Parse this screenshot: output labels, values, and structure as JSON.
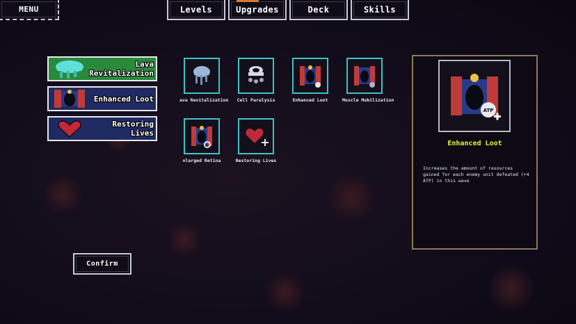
{
  "header": {
    "menu_label": "MENU",
    "nav": [
      {
        "label": "Levels"
      },
      {
        "label": "Upgrades"
      },
      {
        "label": "Deck"
      },
      {
        "label": "Skills"
      }
    ]
  },
  "selected_list": [
    {
      "line1": "Lava",
      "line2": "Revitalization",
      "icon": "lava-jellyfish-icon",
      "color": "#2a8a3c"
    },
    {
      "line1": "Enhanced Loot",
      "line2": "",
      "icon": "enhanced-loot-icon",
      "color": "#1f2a63"
    },
    {
      "line1": "Restoring",
      "line2": "Lives",
      "icon": "heart-icon",
      "color": "#1f2a63"
    }
  ],
  "upgrades": [
    {
      "label": "ava Revitalization",
      "icon": "lava-jellyfish-icon"
    },
    {
      "label": "Cell Paralysis",
      "icon": "cell-jellyfish-icon"
    },
    {
      "label": "Enhanced Loot",
      "icon": "enhanced-loot-icon"
    },
    {
      "label": "Muscle Mobilization",
      "icon": "muscle-gate-icon"
    },
    {
      "label": "nlarged Retina",
      "icon": "retina-gate-icon"
    },
    {
      "label": "Restoring Lives",
      "icon": "heart-plus-icon"
    }
  ],
  "detail": {
    "title": "Enhanced Loot",
    "description": "Increases the amount of resources gained for each enemy unit defeated (+4 ATP) in this wave",
    "badge": "ATP"
  },
  "confirm_label": "Confirm",
  "colors": {
    "accent": "#3ec4c4",
    "title": "#e0f040",
    "card_green": "#2a8a3c",
    "card_blue": "#1f2a63"
  }
}
